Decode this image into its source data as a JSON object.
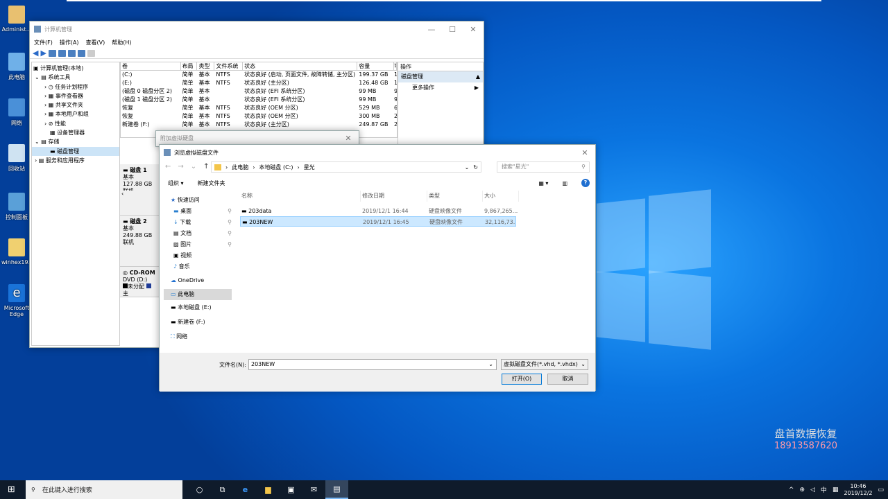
{
  "desktop": {
    "icons": [
      "Administ...",
      "此电脑",
      "网络",
      "回收站",
      "控制面板",
      "winhex19...",
      "Microsoft Edge"
    ],
    "watermark": "盘首数据恢复",
    "watermark_phone": "18913587620"
  },
  "cm": {
    "title": "计算机管理",
    "menu": [
      "文件(F)",
      "操作(A)",
      "查看(V)",
      "帮助(H)"
    ],
    "tree": [
      "计算机管理(本地)",
      "系统工具",
      "任务计划程序",
      "事件查看器",
      "共享文件夹",
      "本地用户和组",
      "性能",
      "设备管理器",
      "存储",
      "磁盘管理",
      "服务和应用程序"
    ],
    "cols": [
      "卷",
      "布局",
      "类型",
      "文件系统",
      "状态",
      "容量",
      "可"
    ],
    "rows": [
      [
        "(C:)",
        "简单",
        "基本",
        "NTFS",
        "状态良好 (启动, 页面文件, 故障转储, 主分区)",
        "199.37 GB",
        "1"
      ],
      [
        "(E:)",
        "简单",
        "基本",
        "NTFS",
        "状态良好 (主分区)",
        "126.48 GB",
        "1"
      ],
      [
        "(磁盘 0 磁盘分区 2)",
        "简单",
        "基本",
        "",
        "状态良好 (EFI 系统分区)",
        "99 MB",
        "9"
      ],
      [
        "(磁盘 1 磁盘分区 2)",
        "简单",
        "基本",
        "",
        "状态良好 (EFI 系统分区)",
        "99 MB",
        "9"
      ],
      [
        "恢复",
        "简单",
        "基本",
        "NTFS",
        "状态良好 (OEM 分区)",
        "529 MB",
        "6"
      ],
      [
        "恢复",
        "简单",
        "基本",
        "NTFS",
        "状态良好 (OEM 分区)",
        "300 MB",
        "2"
      ],
      [
        "新建卷 (F:)",
        "简单",
        "基本",
        "NTFS",
        "状态良好 (主分区)",
        "249.87 GB",
        "2"
      ]
    ],
    "actions": {
      "header": "操作",
      "section": "磁盘管理",
      "more": "更多操作"
    },
    "disks": [
      {
        "name": "磁盘 1",
        "type": "基本",
        "size": "127.88 GB",
        "state": "联机"
      },
      {
        "name": "磁盘 2",
        "type": "基本",
        "size": "249.88 GB",
        "state": "联机"
      },
      {
        "name": "CD-ROM",
        "type": "DVD (D:)",
        "size": "",
        "state": ""
      }
    ],
    "legend": [
      "未分配",
      "主"
    ]
  },
  "attach": {
    "title": "附加虚拟硬盘"
  },
  "browse": {
    "title": "浏览虚拟磁盘文件",
    "path": [
      "此电脑",
      "本地磁盘 (C:)",
      "星光"
    ],
    "search": "搜索\"星光\"",
    "organize": "组织 ▾",
    "newfolder": "新建文件夹",
    "nav": [
      "快速访问",
      "桌面",
      "下载",
      "文档",
      "图片",
      "视频",
      "音乐",
      "OneDrive",
      "此电脑",
      "本地磁盘 (E:)",
      "新建卷 (F:)",
      "网络"
    ],
    "cols": [
      "名称",
      "修改日期",
      "类型",
      "大小"
    ],
    "files": [
      [
        "203data",
        "2019/12/1 16:44",
        "硬盘映像文件",
        "9,867,265..."
      ],
      [
        "203NEW",
        "2019/12/1 16:45",
        "硬盘映像文件",
        "32,116,73..."
      ]
    ],
    "filename_label": "文件名(N):",
    "filename": "203NEW",
    "filter": "虚拟磁盘文件(*.vhd, *.vhdx)",
    "open": "打开(O)",
    "cancel": "取消"
  },
  "taskbar": {
    "search": "在此键入进行搜索",
    "ime": "中",
    "time": "10:46",
    "date": "2019/12/2"
  }
}
